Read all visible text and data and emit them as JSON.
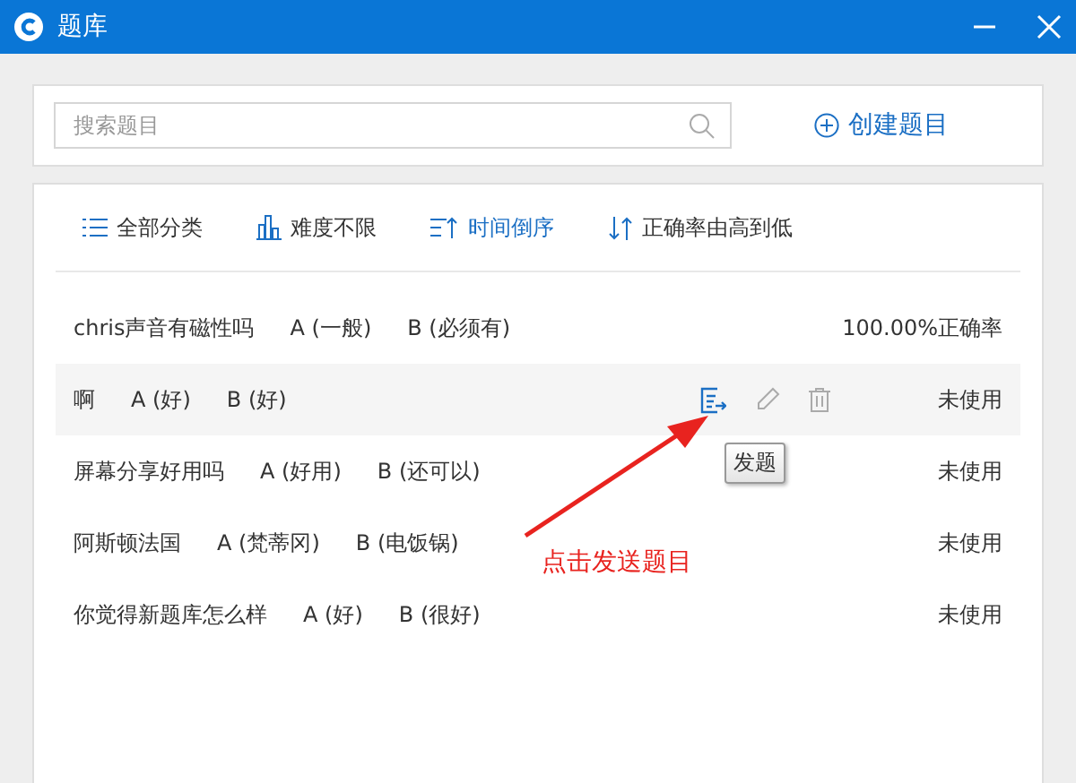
{
  "window": {
    "title": "题库"
  },
  "search": {
    "placeholder": "搜索题目"
  },
  "create_button": {
    "label": "创建题目"
  },
  "filters": [
    {
      "label": "全部分类",
      "kind": "list",
      "selected": false
    },
    {
      "label": "难度不限",
      "kind": "bars",
      "selected": false
    },
    {
      "label": "时间倒序",
      "kind": "sort-time",
      "selected": true
    },
    {
      "label": "正确率由高到低",
      "kind": "sort-rate",
      "selected": false
    }
  ],
  "questions": [
    {
      "question": "chris声音有磁性吗",
      "option_a": "A (一般)",
      "option_b": "B (必须有)",
      "status": "100.00%正确率",
      "hovered": false
    },
    {
      "question": "啊",
      "option_a": "A (好)",
      "option_b": "B (好)",
      "status": "未使用",
      "hovered": true
    },
    {
      "question": "屏幕分享好用吗",
      "option_a": "A (好用)",
      "option_b": "B (还可以)",
      "status": "未使用",
      "hovered": false
    },
    {
      "question": "阿斯顿法国",
      "option_a": "A (梵蒂冈)",
      "option_b": "B (电饭锅)",
      "status": "未使用",
      "hovered": false
    },
    {
      "question": "你觉得新题库怎么样",
      "option_a": "A (好)",
      "option_b": "B (很好)",
      "status": "未使用",
      "hovered": false
    }
  ],
  "tooltip": {
    "text": "发题"
  },
  "annotation": {
    "text": "点击发送题目"
  }
}
